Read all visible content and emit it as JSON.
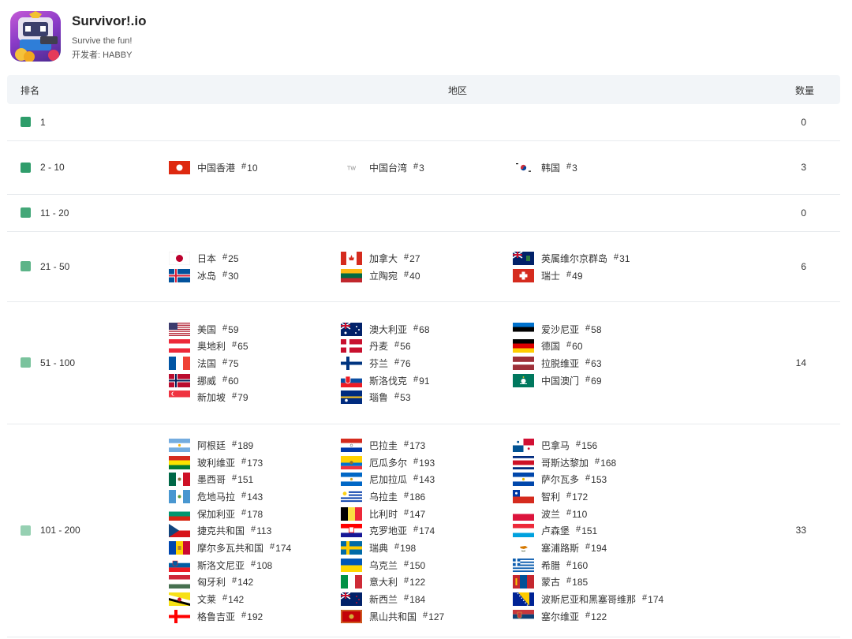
{
  "app": {
    "title": "Survivor!.io",
    "subtitle": "Survive the fun!",
    "developer": "开发者: HABBY"
  },
  "table": {
    "headers": {
      "rank": "排名",
      "region": "地区",
      "count": "数量"
    },
    "rows": [
      {
        "rank": "1",
        "color": "#2e9d6a",
        "count": "0",
        "columns": [
          [],
          [],
          []
        ]
      },
      {
        "rank": "2 - 10",
        "color": "#2f9d6b",
        "count": "3",
        "columns": [
          [
            {
              "name": "中国香港",
              "rank": "10",
              "flag": "hk"
            }
          ],
          [
            {
              "name": "中国台湾",
              "rank": "3",
              "flag": "tw"
            }
          ],
          [
            {
              "name": "韩国",
              "rank": "3",
              "flag": "kr"
            }
          ]
        ]
      },
      {
        "rank": "11 - 20",
        "color": "#43a778",
        "count": "0",
        "columns": [
          [],
          [],
          []
        ]
      },
      {
        "rank": "21 - 50",
        "color": "#5cb488",
        "count": "6",
        "columns": [
          [
            {
              "name": "日本",
              "rank": "25",
              "flag": "jp"
            },
            {
              "name": "冰岛",
              "rank": "30",
              "flag": "is"
            }
          ],
          [
            {
              "name": "加拿大",
              "rank": "27",
              "flag": "ca"
            },
            {
              "name": "立陶宛",
              "rank": "40",
              "flag": "lt"
            }
          ],
          [
            {
              "name": "英属维尔京群岛",
              "rank": "31",
              "flag": "vg"
            },
            {
              "name": "瑞士",
              "rank": "49",
              "flag": "ch"
            }
          ]
        ]
      },
      {
        "rank": "51 - 100",
        "color": "#7ac39d",
        "count": "14",
        "columns": [
          [
            {
              "name": "美国",
              "rank": "59",
              "flag": "us"
            },
            {
              "name": "奥地利",
              "rank": "65",
              "flag": "at"
            },
            {
              "name": "法国",
              "rank": "75",
              "flag": "fr"
            },
            {
              "name": "挪威",
              "rank": "60",
              "flag": "no"
            },
            {
              "name": "新加坡",
              "rank": "79",
              "flag": "sg"
            }
          ],
          [
            {
              "name": "澳大利亚",
              "rank": "68",
              "flag": "au"
            },
            {
              "name": "丹麦",
              "rank": "56",
              "flag": "dk"
            },
            {
              "name": "芬兰",
              "rank": "76",
              "flag": "fi"
            },
            {
              "name": "斯洛伐克",
              "rank": "91",
              "flag": "sk"
            },
            {
              "name": "瑙鲁",
              "rank": "53",
              "flag": "nr"
            }
          ],
          [
            {
              "name": "爱沙尼亚",
              "rank": "58",
              "flag": "ee"
            },
            {
              "name": "德国",
              "rank": "60",
              "flag": "de"
            },
            {
              "name": "拉脱维亚",
              "rank": "63",
              "flag": "lv"
            },
            {
              "name": "中国澳门",
              "rank": "69",
              "flag": "mo"
            }
          ]
        ]
      },
      {
        "rank": "101 - 200",
        "color": "#96d0b2",
        "count": "33",
        "columns": [
          [
            {
              "name": "阿根廷",
              "rank": "189",
              "flag": "ar"
            },
            {
              "name": "玻利维亚",
              "rank": "173",
              "flag": "bo"
            },
            {
              "name": "墨西哥",
              "rank": "151",
              "flag": "mx"
            },
            {
              "name": "危地马拉",
              "rank": "143",
              "flag": "gt"
            },
            {
              "name": "保加利亚",
              "rank": "178",
              "flag": "bg"
            },
            {
              "name": "捷克共和国",
              "rank": "113",
              "flag": "cz"
            },
            {
              "name": "摩尔多瓦共和国",
              "rank": "174",
              "flag": "md"
            },
            {
              "name": "斯洛文尼亚",
              "rank": "108",
              "flag": "si"
            },
            {
              "name": "匈牙利",
              "rank": "142",
              "flag": "hu"
            },
            {
              "name": "文莱",
              "rank": "142",
              "flag": "bn"
            },
            {
              "name": "格鲁吉亚",
              "rank": "192",
              "flag": "ge"
            }
          ],
          [
            {
              "name": "巴拉圭",
              "rank": "173",
              "flag": "py"
            },
            {
              "name": "厄瓜多尔",
              "rank": "193",
              "flag": "ec"
            },
            {
              "name": "尼加拉瓜",
              "rank": "143",
              "flag": "ni"
            },
            {
              "name": "乌拉圭",
              "rank": "186",
              "flag": "uy"
            },
            {
              "name": "比利时",
              "rank": "147",
              "flag": "be"
            },
            {
              "name": "克罗地亚",
              "rank": "174",
              "flag": "hr"
            },
            {
              "name": "瑞典",
              "rank": "198",
              "flag": "se"
            },
            {
              "name": "乌克兰",
              "rank": "150",
              "flag": "ua"
            },
            {
              "name": "意大利",
              "rank": "122",
              "flag": "it"
            },
            {
              "name": "新西兰",
              "rank": "184",
              "flag": "nz"
            },
            {
              "name": "黑山共和国",
              "rank": "127",
              "flag": "me"
            }
          ],
          [
            {
              "name": "巴拿马",
              "rank": "156",
              "flag": "pa"
            },
            {
              "name": "哥斯达黎加",
              "rank": "168",
              "flag": "cr"
            },
            {
              "name": "萨尔瓦多",
              "rank": "153",
              "flag": "sv"
            },
            {
              "name": "智利",
              "rank": "172",
              "flag": "cl"
            },
            {
              "name": "波兰",
              "rank": "110",
              "flag": "pl"
            },
            {
              "name": "卢森堡",
              "rank": "151",
              "flag": "lu"
            },
            {
              "name": "塞浦路斯",
              "rank": "194",
              "flag": "cy"
            },
            {
              "name": "希腊",
              "rank": "160",
              "flag": "gr"
            },
            {
              "name": "蒙古",
              "rank": "185",
              "flag": "mn"
            },
            {
              "name": "波斯尼亚和黑塞哥维那",
              "rank": "174",
              "flag": "ba"
            },
            {
              "name": "塞尔维亚",
              "rank": "122",
              "flag": "rs"
            }
          ]
        ]
      }
    ]
  }
}
